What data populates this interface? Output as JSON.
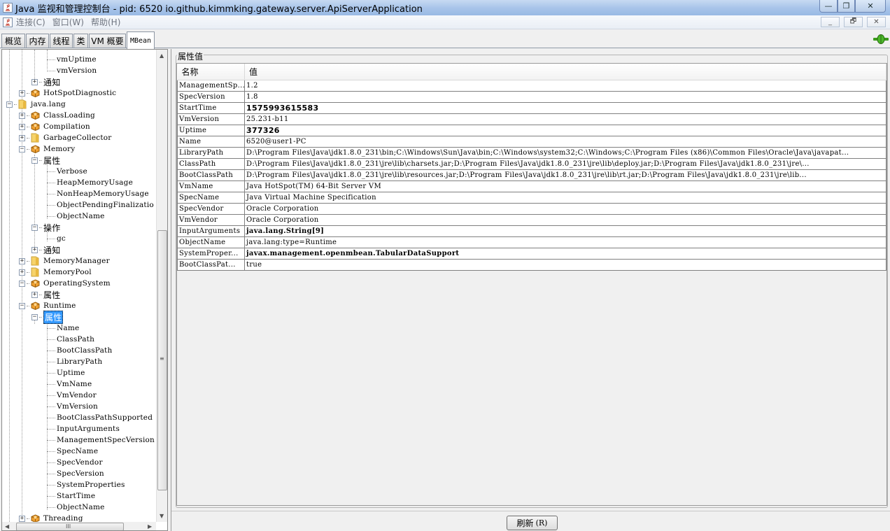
{
  "window": {
    "title": "Java 监视和管理控制台 - pid: 6520 io.github.kimmking.gateway.server.ApiServerApplication",
    "controls": {
      "minimize": "—",
      "maximize": "❐",
      "close": "✕"
    }
  },
  "menubar": {
    "items": [
      {
        "label": "连接(C)"
      },
      {
        "label": "窗口(W)"
      },
      {
        "label": "帮助(H)"
      }
    ],
    "mdi_controls": {
      "minimize": "_",
      "restore": "🗗",
      "close": "✕"
    }
  },
  "tabs": [
    {
      "label": "概览",
      "active": false
    },
    {
      "label": "内存",
      "active": false
    },
    {
      "label": "线程",
      "active": false
    },
    {
      "label": "类",
      "active": false
    },
    {
      "label": "VM 概要",
      "active": false
    },
    {
      "label": "MBean",
      "active": true
    }
  ],
  "connection_status": "connected",
  "tree": {
    "rows": [
      {
        "label": "vmUptime",
        "level": 4,
        "type": "leaf"
      },
      {
        "label": "vmVersion",
        "level": 4,
        "type": "leaf",
        "last": true
      },
      {
        "label": "通知",
        "level": 3,
        "type": "group",
        "expanded": false
      },
      {
        "label": "HotSpotDiagnostic",
        "level": 2,
        "type": "bean",
        "expanded": false
      },
      {
        "label": "java.lang",
        "level": 1,
        "type": "folder",
        "expanded": true
      },
      {
        "label": "ClassLoading",
        "level": 2,
        "type": "bean",
        "expanded": false
      },
      {
        "label": "Compilation",
        "level": 2,
        "type": "bean",
        "expanded": false
      },
      {
        "label": "GarbageCollector",
        "level": 2,
        "type": "folder",
        "expanded": false
      },
      {
        "label": "Memory",
        "level": 2,
        "type": "bean",
        "expanded": true
      },
      {
        "label": "属性",
        "level": 3,
        "type": "group",
        "expanded": true
      },
      {
        "label": "Verbose",
        "level": 4,
        "type": "leaf"
      },
      {
        "label": "HeapMemoryUsage",
        "level": 4,
        "type": "leaf"
      },
      {
        "label": "NonHeapMemoryUsage",
        "level": 4,
        "type": "leaf"
      },
      {
        "label": "ObjectPendingFinalizatio",
        "level": 4,
        "type": "leaf"
      },
      {
        "label": "ObjectName",
        "level": 4,
        "type": "leaf",
        "last": true
      },
      {
        "label": "操作",
        "level": 3,
        "type": "group",
        "expanded": true
      },
      {
        "label": "gc",
        "level": 4,
        "type": "leaf",
        "last": true
      },
      {
        "label": "通知",
        "level": 3,
        "type": "group",
        "expanded": false
      },
      {
        "label": "MemoryManager",
        "level": 2,
        "type": "folder",
        "expanded": false
      },
      {
        "label": "MemoryPool",
        "level": 2,
        "type": "folder",
        "expanded": false
      },
      {
        "label": "OperatingSystem",
        "level": 2,
        "type": "bean",
        "expanded": true
      },
      {
        "label": "属性",
        "level": 3,
        "type": "group",
        "expanded": false
      },
      {
        "label": "Runtime",
        "level": 2,
        "type": "bean",
        "expanded": true
      },
      {
        "label": "属性",
        "level": 3,
        "type": "group",
        "expanded": true,
        "selected": true
      },
      {
        "label": "Name",
        "level": 4,
        "type": "leaf"
      },
      {
        "label": "ClassPath",
        "level": 4,
        "type": "leaf"
      },
      {
        "label": "BootClassPath",
        "level": 4,
        "type": "leaf"
      },
      {
        "label": "LibraryPath",
        "level": 4,
        "type": "leaf"
      },
      {
        "label": "Uptime",
        "level": 4,
        "type": "leaf"
      },
      {
        "label": "VmName",
        "level": 4,
        "type": "leaf"
      },
      {
        "label": "VmVendor",
        "level": 4,
        "type": "leaf"
      },
      {
        "label": "VmVersion",
        "level": 4,
        "type": "leaf"
      },
      {
        "label": "BootClassPathSupported",
        "level": 4,
        "type": "leaf"
      },
      {
        "label": "InputArguments",
        "level": 4,
        "type": "leaf"
      },
      {
        "label": "ManagementSpecVersion",
        "level": 4,
        "type": "leaf"
      },
      {
        "label": "SpecName",
        "level": 4,
        "type": "leaf"
      },
      {
        "label": "SpecVendor",
        "level": 4,
        "type": "leaf"
      },
      {
        "label": "SpecVersion",
        "level": 4,
        "type": "leaf"
      },
      {
        "label": "SystemProperties",
        "level": 4,
        "type": "leaf"
      },
      {
        "label": "StartTime",
        "level": 4,
        "type": "leaf"
      },
      {
        "label": "ObjectName",
        "level": 4,
        "type": "leaf",
        "last": true
      },
      {
        "label": "Threading",
        "level": 2,
        "type": "bean",
        "expanded": false
      }
    ],
    "scroll_thumb_grip": "≡",
    "hscroll_grip": "III"
  },
  "attributes": {
    "group_title": "属性值",
    "columns": {
      "name": "名称",
      "value": "值"
    },
    "rows": [
      {
        "name": "ManagementSp...",
        "value": "1.2",
        "style": ""
      },
      {
        "name": "SpecVersion",
        "value": "1.8",
        "style": ""
      },
      {
        "name": "StartTime",
        "value": "1575993615583",
        "style": "sans-bold"
      },
      {
        "name": "VmVersion",
        "value": "25.231-b11",
        "style": ""
      },
      {
        "name": "Uptime",
        "value": "377326",
        "style": "sans-bold"
      },
      {
        "name": "Name",
        "value": "6520@user1-PC",
        "style": ""
      },
      {
        "name": "LibraryPath",
        "value": "D:\\Program Files\\Java\\jdk1.8.0_231\\bin;C:\\Windows\\Sun\\Java\\bin;C:\\Windows\\system32;C:\\Windows;C:\\Program Files (x86)\\Common Files\\Oracle\\Java\\javapat...",
        "style": ""
      },
      {
        "name": "ClassPath",
        "value": "D:\\Program Files\\Java\\jdk1.8.0_231\\jre\\lib\\charsets.jar;D:\\Program Files\\Java\\jdk1.8.0_231\\jre\\lib\\deploy.jar;D:\\Program Files\\Java\\jdk1.8.0_231\\jre\\...",
        "style": ""
      },
      {
        "name": "BootClassPath",
        "value": "D:\\Program Files\\Java\\jdk1.8.0_231\\jre\\lib\\resources.jar;D:\\Program Files\\Java\\jdk1.8.0_231\\jre\\lib\\rt.jar;D:\\Program Files\\Java\\jdk1.8.0_231\\jre\\lib...",
        "style": ""
      },
      {
        "name": "VmName",
        "value": "Java HotSpot(TM) 64-Bit Server VM",
        "style": ""
      },
      {
        "name": "SpecName",
        "value": "Java Virtual Machine Specification",
        "style": ""
      },
      {
        "name": "SpecVendor",
        "value": "Oracle Corporation",
        "style": ""
      },
      {
        "name": "VmVendor",
        "value": "Oracle Corporation",
        "style": ""
      },
      {
        "name": "InputArguments",
        "value": "java.lang.String[9]",
        "style": "bold"
      },
      {
        "name": "ObjectName",
        "value": "java.lang:type=Runtime",
        "style": ""
      },
      {
        "name": "SystemProper...",
        "value": "javax.management.openmbean.TabularDataSupport",
        "style": "bold"
      },
      {
        "name": "BootClassPat...",
        "value": "true",
        "style": ""
      }
    ]
  },
  "refresh_button": {
    "label": "刷新",
    "mnemonic": "(R)"
  }
}
